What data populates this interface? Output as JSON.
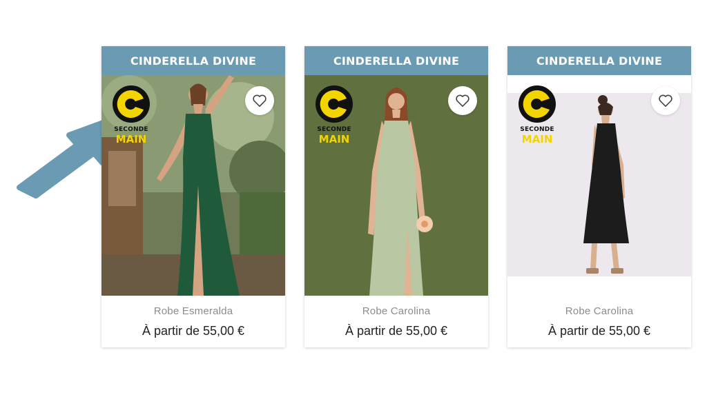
{
  "colors": {
    "brand_header": "#6b9bb3",
    "arrow": "#6b9bb3",
    "badge_yellow": "#f2d500",
    "badge_black": "#111111"
  },
  "badge": {
    "line1": "SECONDE",
    "line2": "MAIN"
  },
  "products": [
    {
      "brand": "CINDERELLA DIVINE",
      "name": "Robe Esmeralda",
      "price": "À partir de 55,00 €",
      "favorite_icon": "heart-outline-icon",
      "dress_color": "#1f5a3a"
    },
    {
      "brand": "CINDERELLA DIVINE",
      "name": "Robe Carolina",
      "price": "À partir de 55,00 €",
      "favorite_icon": "heart-outline-icon",
      "dress_color": "#b9c8a3"
    },
    {
      "brand": "CINDERELLA DIVINE",
      "name": "Robe Carolina",
      "price": "À partir de 55,00 €",
      "favorite_icon": "heart-outline-icon",
      "dress_color": "#1c1c1c"
    }
  ]
}
